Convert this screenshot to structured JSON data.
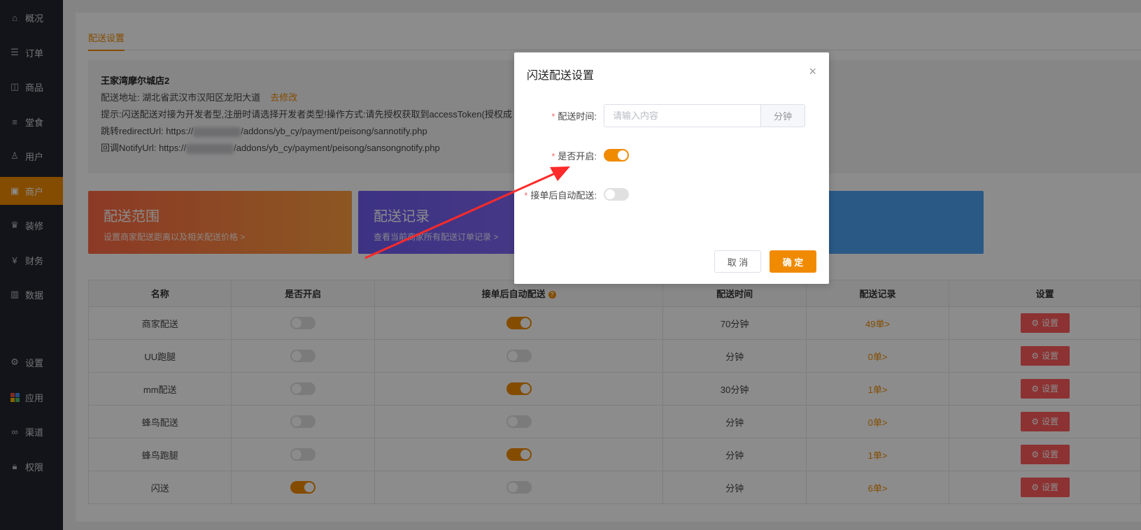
{
  "sidebar": {
    "items": [
      {
        "label": "概况",
        "icon": "home-icon"
      },
      {
        "label": "订单",
        "icon": "order-icon"
      },
      {
        "label": "商品",
        "icon": "goods-icon"
      },
      {
        "label": "堂食",
        "icon": "dinein-icon"
      },
      {
        "label": "用户",
        "icon": "user-icon"
      },
      {
        "label": "商户",
        "icon": "shop-icon"
      },
      {
        "label": "装修",
        "icon": "decorate-icon"
      },
      {
        "label": "财务",
        "icon": "finance-icon"
      },
      {
        "label": "数据",
        "icon": "chart-icon"
      },
      {
        "label": "设置",
        "icon": "gear-icon"
      },
      {
        "label": "应用",
        "icon": "apps-icon"
      },
      {
        "label": "渠道",
        "icon": "link-icon"
      },
      {
        "label": "权限",
        "icon": "lock-icon"
      }
    ],
    "active": "商户",
    "active_color": "#f08a00"
  },
  "tab": {
    "label": "配送设置"
  },
  "info": {
    "store_name": "王家湾摩尔城店2",
    "address_label": "配送地址:",
    "address_value": "湖北省武汉市汉阳区龙阳大道",
    "edit_link": "去修改",
    "hint": "提示:闪送配送对接为开发者型,注册时请选择开发者类型!操作方式:请先授权获取到accessToken(授权成",
    "redirect_label": "跳转redirectUrl:",
    "redirect_prefix": "https://",
    "redirect_suffix": "/addons/yb_cy/payment/peisong/sannotify.php",
    "notify_label": "回调NotifyUrl:",
    "notify_prefix": "https://",
    "notify_suffix": "/addons/yb_cy/payment/peisong/sansongnotify.php"
  },
  "tiles": [
    {
      "title": "配送范围",
      "subtitle": "设置商家配送距离以及相关配送价格 >"
    },
    {
      "title": "配送记录",
      "subtitle": "查看当前商家所有配送订单记录 >"
    }
  ],
  "table": {
    "headers": [
      "名称",
      "是否开启",
      "接单后自动配送",
      "配送时间",
      "配送记录",
      "设置"
    ],
    "tip": "?",
    "set_label": "设置",
    "rows": [
      {
        "name": "商家配送",
        "enabled": false,
        "auto": true,
        "time": "70分钟",
        "records": "49单>"
      },
      {
        "name": "UU跑腿",
        "enabled": false,
        "auto": false,
        "time": "分钟",
        "records": "0单>"
      },
      {
        "name": "mm配送",
        "enabled": false,
        "auto": true,
        "time": "30分钟",
        "records": "1单>"
      },
      {
        "name": "蜂鸟配送",
        "enabled": false,
        "auto": false,
        "time": "分钟",
        "records": "0单>"
      },
      {
        "name": "蜂鸟跑腿",
        "enabled": false,
        "auto": true,
        "time": "分钟",
        "records": "1单>"
      },
      {
        "name": "闪送",
        "enabled": true,
        "auto": false,
        "time": "分钟",
        "records": "6单>"
      }
    ]
  },
  "modal": {
    "title": "闪送配送设置",
    "close": "×",
    "time_label": "配送时间:",
    "time_value": "",
    "time_placeholder": "请输入内容",
    "time_unit": "分钟",
    "enable_label": "是否开启:",
    "enable_on": true,
    "auto_label": "接单后自动配送:",
    "auto_on": false,
    "required_mark": "*",
    "cancel_label": "取 消",
    "ok_label": "确 定"
  },
  "colors": {
    "accent": "#f08a00",
    "danger": "#ff5b5b",
    "annotation": "#ff2a2a"
  }
}
